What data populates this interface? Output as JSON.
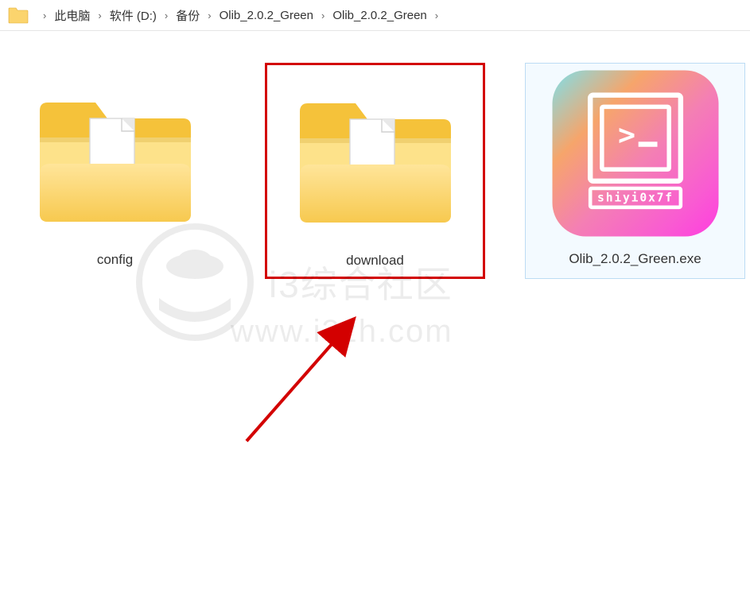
{
  "breadcrumb": {
    "items": [
      "此电脑",
      "软件 (D:)",
      "备份",
      "Olib_2.0.2_Green",
      "Olib_2.0.2_Green"
    ]
  },
  "items": [
    {
      "name": "config",
      "type": "folder"
    },
    {
      "name": "download",
      "type": "folder"
    },
    {
      "name": "Olib_2.0.2_Green.exe",
      "type": "exe"
    }
  ],
  "exe_icon": {
    "badge_text": "shiyi0x7f",
    "prompt": ">_"
  },
  "watermark": {
    "brand": "i3综合社区",
    "url": "www.i3zh.com"
  }
}
